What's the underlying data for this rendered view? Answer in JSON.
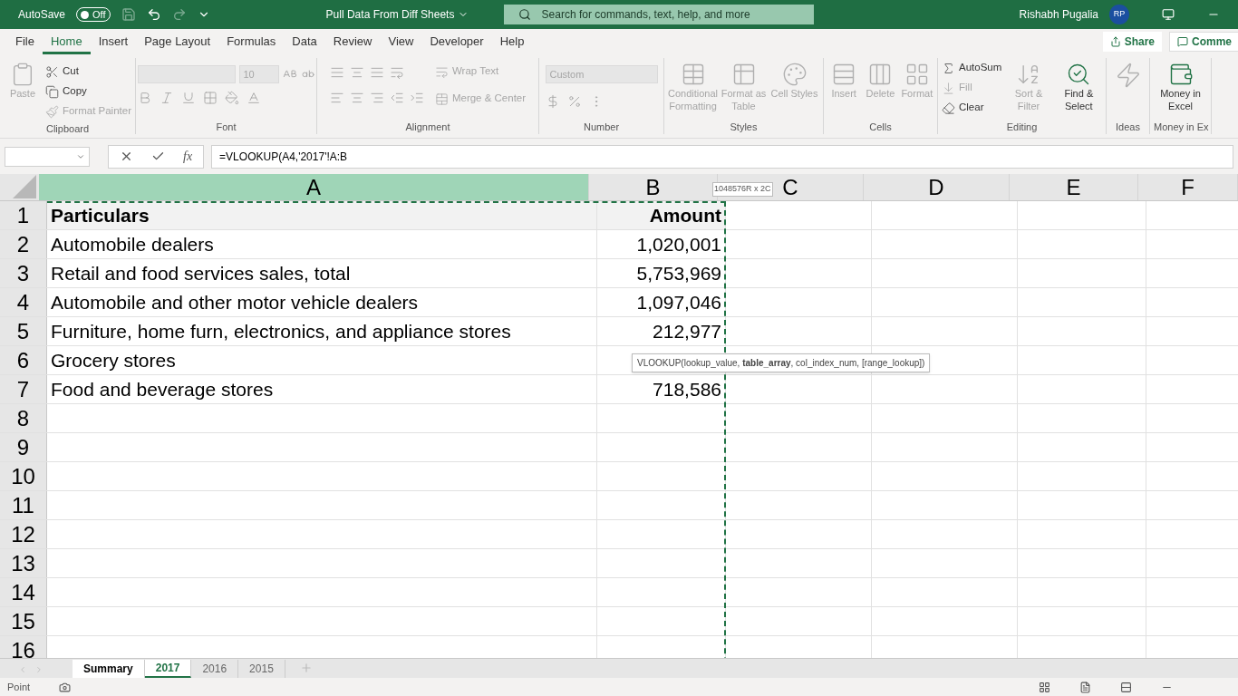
{
  "title_bar": {
    "autosave": "AutoSave",
    "autosave_toggle": {
      "label": "Off",
      "on": false
    },
    "title": "Pull Data From Diff Sheets",
    "search_placeholder": "Search for commands, text, help, and more",
    "user": "Rishabh Pugalia",
    "avatar": "RP"
  },
  "ribbon": {
    "tabs": [
      {
        "label": "File",
        "selected": false
      },
      {
        "label": "Home",
        "selected": true
      },
      {
        "label": "Insert",
        "selected": false
      },
      {
        "label": "Page Layout",
        "selected": false
      },
      {
        "label": "Formulas",
        "selected": false
      },
      {
        "label": "Data",
        "selected": false
      },
      {
        "label": "Review",
        "selected": false
      },
      {
        "label": "View",
        "selected": false
      },
      {
        "label": "Developer",
        "selected": false
      },
      {
        "label": "Help",
        "selected": false
      }
    ],
    "share": "Share",
    "comments": "Comme",
    "groups": [
      {
        "kind": "clipboard",
        "label": "Clipboard",
        "paste": {
          "label": "Paste",
          "disabled": true
        },
        "items": [
          {
            "label": "Cut",
            "disabled": false
          },
          {
            "label": "Copy",
            "disabled": false
          },
          {
            "label": "Format Painter",
            "disabled": true
          }
        ]
      },
      {
        "kind": "font",
        "label": "Font",
        "font_size": "10"
      },
      {
        "kind": "alignment",
        "label": "Alignment",
        "wrap": "Wrap Text",
        "merge": "Merge & Center"
      },
      {
        "kind": "number",
        "label": "Number",
        "format": "Custom"
      },
      {
        "kind": "large",
        "label": "Styles",
        "items": [
          {
            "label": "Conditional Formatting",
            "disabled": true
          },
          {
            "label": "Format as Table",
            "disabled": true
          },
          {
            "label": "Cell Styles",
            "disabled": true
          }
        ]
      },
      {
        "kind": "large",
        "label": "Cells",
        "items": [
          {
            "label": "Insert",
            "disabled": true
          },
          {
            "label": "Delete",
            "disabled": true
          },
          {
            "label": "Format",
            "disabled": true
          }
        ]
      },
      {
        "kind": "editing",
        "label": "Editing",
        "items": [
          {
            "label": "AutoSum",
            "disabled": false
          },
          {
            "label": "Fill",
            "disabled": true
          },
          {
            "label": "Clear",
            "disabled": false
          }
        ],
        "large": [
          {
            "label": "Sort & Filter",
            "disabled": true
          },
          {
            "label": "Find & Select",
            "disabled": false
          }
        ]
      },
      {
        "kind": "ideas",
        "label": "Ideas"
      },
      {
        "kind": "large",
        "label": "Money in Ex",
        "items": [
          {
            "label": "Money in Excel",
            "disabled": false
          }
        ]
      }
    ]
  },
  "formula_bar": {
    "function_button": "fx",
    "formula": "=VLOOKUP(A4,'2017'!A:B"
  },
  "sheet": {
    "columns": [
      {
        "label": "A",
        "selected": true
      },
      {
        "label": "B",
        "selected": false
      },
      {
        "label": "C",
        "selected": false
      },
      {
        "label": "D",
        "selected": false
      },
      {
        "label": "E",
        "selected": false
      },
      {
        "label": "F",
        "selected": false
      }
    ],
    "rows": [
      {
        "number": "1",
        "kind": "header",
        "cells": [
          "Particulars",
          "Amount"
        ]
      },
      {
        "number": "2",
        "kind": "data",
        "cells": [
          "Automobile dealers",
          "1,020,001"
        ]
      },
      {
        "number": "3",
        "kind": "data",
        "cells": [
          "Retail and food services sales, total",
          "5,753,969"
        ]
      },
      {
        "number": "4",
        "kind": "data",
        "cells": [
          "Automobile and other motor vehicle dealers",
          "1,097,046"
        ]
      },
      {
        "number": "5",
        "kind": "data",
        "cells": [
          "Furniture, home furn, electronics, and appliance stores",
          "212,977"
        ]
      },
      {
        "number": "6",
        "kind": "data",
        "cells": [
          "Grocery stores"
        ]
      },
      {
        "number": "7",
        "kind": "data",
        "cells": [
          "Food and beverage stores",
          "718,586"
        ]
      },
      {
        "number": "8",
        "kind": "data",
        "cells": []
      },
      {
        "number": "9",
        "kind": "data",
        "cells": []
      },
      {
        "number": "10",
        "kind": "data",
        "cells": []
      },
      {
        "number": "11",
        "kind": "data",
        "cells": []
      },
      {
        "number": "12",
        "kind": "data",
        "cells": []
      },
      {
        "number": "13",
        "kind": "data",
        "cells": []
      },
      {
        "number": "14",
        "kind": "data",
        "cells": []
      },
      {
        "number": "15",
        "kind": "data",
        "cells": []
      },
      {
        "number": "16",
        "kind": "data",
        "cells": []
      }
    ],
    "range_tip": "1048576R x 2C",
    "function_tip": "VLOOKUP(lookup_value, **table_array**, col_index_num, [range_lookup])"
  },
  "sheet_tabs": [
    {
      "label": "Summary",
      "selected": true,
      "active": false
    },
    {
      "label": "2017",
      "selected": true,
      "active": true
    },
    {
      "label": "2016",
      "selected": false,
      "active": false
    },
    {
      "label": "2015",
      "selected": false,
      "active": false
    }
  ],
  "status_bar": {
    "mode": "Point"
  }
}
